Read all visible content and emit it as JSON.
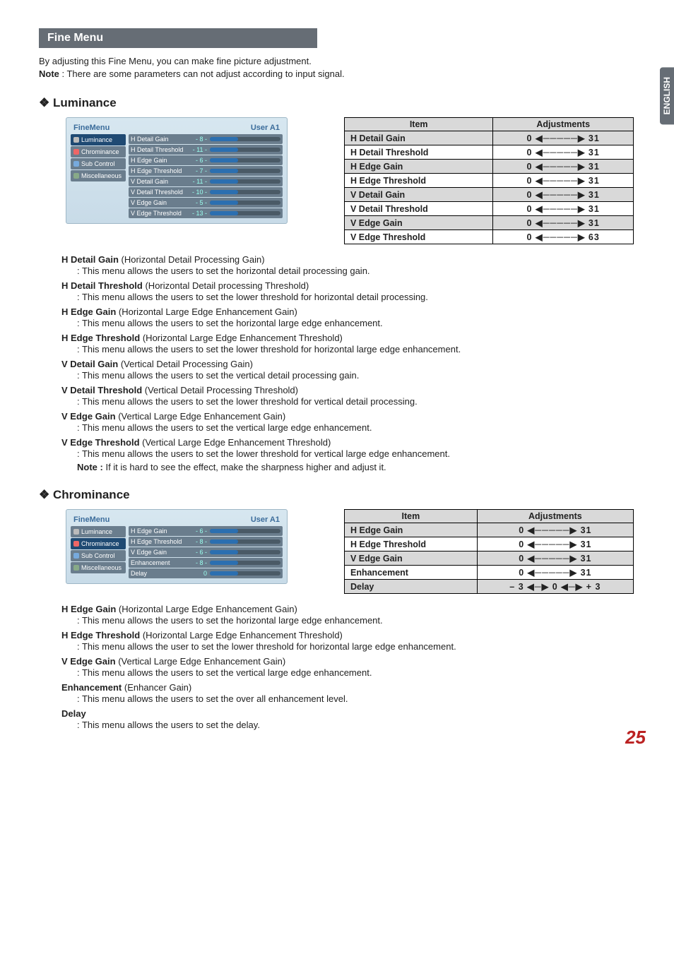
{
  "langTab": "ENGLISH",
  "pageNum": "25",
  "barTitle": "Fine Menu",
  "intro1": "By adjusting this Fine Menu, you can make fine picture adjustment.",
  "introNoteLabel": "Note",
  "intro2": " : There are some parameters can not adjust according to input signal.",
  "sec1": "Luminance",
  "sec2": "Chrominance",
  "osdTitle": "FineMenu",
  "osdUser": "User A1",
  "tabs": {
    "lum": "Luminance",
    "chr": "Chrominance",
    "sub": "Sub Control",
    "mis": "Miscellaneous"
  },
  "osd1": [
    {
      "n": "H Detail Gain",
      "v": "- 8 -"
    },
    {
      "n": "H Detail Threshold",
      "v": "- 11 -"
    },
    {
      "n": "H Edge Gain",
      "v": "- 6 -"
    },
    {
      "n": "H Edge Threshold",
      "v": "- 7 -"
    },
    {
      "n": "V Detail Gain",
      "v": "- 11 -"
    },
    {
      "n": "V Detail Threshold",
      "v": "- 10 -"
    },
    {
      "n": "V Edge Gain",
      "v": "- 5 -"
    },
    {
      "n": "V Edge Threshold",
      "v": "- 13 -"
    }
  ],
  "osd2": [
    {
      "n": "H Edge Gain",
      "v": "- 6 -"
    },
    {
      "n": "H Edge Threshold",
      "v": "- 8 -"
    },
    {
      "n": "V Edge Gain",
      "v": "- 6 -"
    },
    {
      "n": "Enhancement",
      "v": "- 8 -"
    },
    {
      "n": "Delay",
      "v": "0"
    }
  ],
  "tbl": {
    "h1": "Item",
    "h2": "Adjustments"
  },
  "tbl1": [
    {
      "i": "H Detail Gain",
      "a": "0 ◀─────▶ 31",
      "alt": true
    },
    {
      "i": "H Detail Threshold",
      "a": "0 ◀─────▶ 31",
      "alt": false
    },
    {
      "i": "H Edge Gain",
      "a": "0 ◀─────▶ 31",
      "alt": true
    },
    {
      "i": "H Edge Threshold",
      "a": "0 ◀─────▶ 31",
      "alt": false
    },
    {
      "i": "V Detail Gain",
      "a": "0 ◀─────▶ 31",
      "alt": true
    },
    {
      "i": "V Detail Threshold",
      "a": "0 ◀─────▶ 31",
      "alt": false
    },
    {
      "i": "V Edge Gain",
      "a": "0 ◀─────▶ 31",
      "alt": true
    },
    {
      "i": "V Edge Threshold",
      "a": "0 ◀─────▶ 63",
      "alt": false
    }
  ],
  "tbl2": [
    {
      "i": "H Edge Gain",
      "a": "0 ◀─────▶ 31",
      "alt": true
    },
    {
      "i": "H Edge Threshold",
      "a": "0 ◀─────▶ 31",
      "alt": false
    },
    {
      "i": "V Edge Gain",
      "a": "0 ◀─────▶ 31",
      "alt": true
    },
    {
      "i": "Enhancement",
      "a": "0 ◀─────▶ 31",
      "alt": false
    },
    {
      "i": "Delay",
      "a": "– 3 ◀─▶ 0 ◀─▶ + 3",
      "alt": true
    }
  ],
  "defs1": [
    {
      "t": "H Detail Gain",
      "s": " (Horizontal Detail Processing Gain)",
      "d": ": This menu allows the users to set the horizontal detail processing gain."
    },
    {
      "t": "H Detail Threshold",
      "s": " (Horizontal Detail processing Threshold)",
      "d": ": This menu allows the users to set the lower threshold for horizontal detail processing."
    },
    {
      "t": "H Edge Gain",
      "s": " (Horizontal Large Edge Enhancement Gain)",
      "d": ": This menu allows the users to set the horizontal large edge enhancement."
    },
    {
      "t": "H Edge Threshold",
      "s": " (Horizontal Large Edge Enhancement Threshold)",
      "d": ": This menu allows the users to set the lower threshold for horizontal large edge enhancement."
    },
    {
      "t": "V Detail Gain",
      "s": " (Vertical Detail Processing Gain)",
      "d": ": This menu allows the users to set the vertical detail processing gain."
    },
    {
      "t": "V Detail Threshold",
      "s": " (Vertical Detail Processing Threshold)",
      "d": ": This menu allows the users to set the lower threshold for vertical detail processing."
    },
    {
      "t": "V Edge Gain",
      "s": " (Vertical Large Edge Enhancement Gain)",
      "d": ": This menu allows the users to set the vertical large edge enhancement."
    },
    {
      "t": "V Edge Threshold",
      "s": " (Vertical Large Edge Enhancement Threshold)",
      "d": ": This menu allows the users to set the lower threshold for vertical large edge enhancement."
    }
  ],
  "note1Label": "Note :",
  "note1": " If it is hard to see the effect, make the sharpness higher and adjust it.",
  "defs2": [
    {
      "t": "H Edge Gain",
      "s": " (Horizontal Large Edge Enhancement Gain)",
      "d": ": This menu allows the users to set the horizontal large edge enhancement."
    },
    {
      "t": "H Edge Threshold",
      "s": " (Horizontal Large Edge Enhancement Threshold)",
      "d": ": This menu allows the user to set the lower threshold for horizontal large edge enhancement."
    },
    {
      "t": "V Edge Gain",
      "s": " (Vertical Large Edge Enhancement Gain)",
      "d": ": This menu allows the users to set the vertical large edge enhancement."
    },
    {
      "t": "Enhancement",
      "s": " (Enhancer Gain)",
      "d": ": This menu allows the users to set the over all enhancement level."
    },
    {
      "t": "Delay",
      "s": "",
      "d": ": This menu allows the users to set the delay."
    }
  ]
}
